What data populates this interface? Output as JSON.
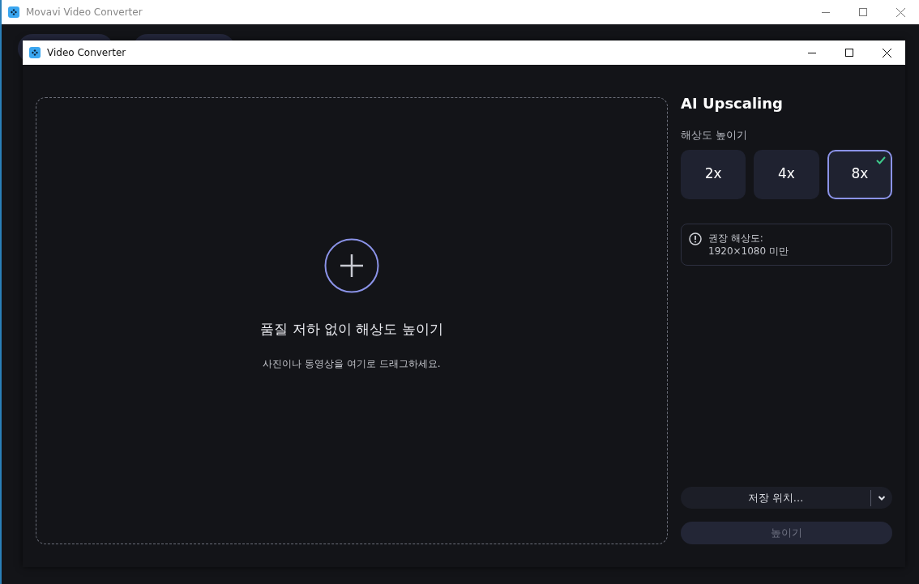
{
  "main_window": {
    "title": "Movavi Video Converter"
  },
  "dialog": {
    "title": "Video Converter"
  },
  "drop_zone": {
    "heading": "품질 저하 없이 해상도 높이기",
    "hint": "사진이나 동영상을 여기로 드래그하세요."
  },
  "panel": {
    "title": "AI Upscaling",
    "label": "해상도 높이기",
    "scales": [
      {
        "label": "2x",
        "selected": false
      },
      {
        "label": "4x",
        "selected": false
      },
      {
        "label": "8x",
        "selected": true
      }
    ],
    "notice": "권장 해상도:\n1920×1080 미만"
  },
  "save_location": {
    "label": "저장 위치..."
  },
  "upscale_button": {
    "label": "높이기",
    "disabled": true
  }
}
